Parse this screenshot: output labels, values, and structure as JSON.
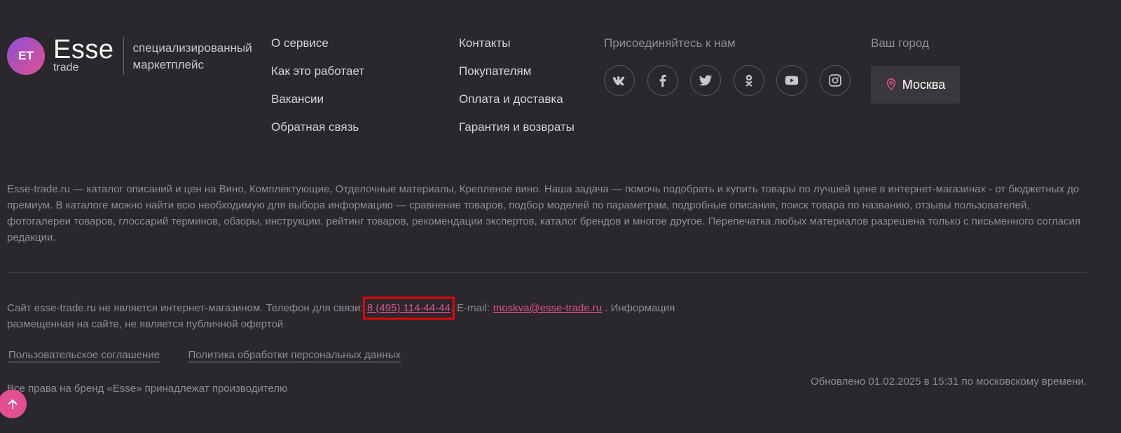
{
  "logo": {
    "initials": "ET",
    "name": "Esse",
    "sub": "trade",
    "tagline": "специализированный маркетплейс"
  },
  "nav_col1": [
    {
      "label": "О сервисе"
    },
    {
      "label": "Как это работает"
    },
    {
      "label": "Вакансии"
    },
    {
      "label": "Обратная связь"
    }
  ],
  "nav_col2": [
    {
      "label": "Контакты"
    },
    {
      "label": "Покупателям"
    },
    {
      "label": "Оплата и доставка"
    },
    {
      "label": "Гарантия и возвраты"
    }
  ],
  "social": {
    "title": "Присоединяйтесь к нам",
    "icons": [
      "vk-icon",
      "facebook-icon",
      "twitter-icon",
      "odnoklassniki-icon",
      "youtube-icon",
      "instagram-icon"
    ]
  },
  "city": {
    "title": "Ваш город",
    "value": "Москва"
  },
  "about": "Esse-trade.ru — каталог описаний и цен на Вино, Комплектующие, Отделочные материалы, Крепленое вино. Наша задача — помочь подобрать и купить товары по лучшей цене в интернет-магазинах - от бюджетных до премиум. В каталоге можно найти всю необходимую для выбора информацию — сравнение товаров, подбор моделей по параметрам, подробные описания, поиск товара по названию, отзывы пользователей, фотогалереи товаров, глоссарий терминов, обзоры, инструкции, рейтинг товаров, рекомендации экспертов, каталог брендов и многое другое. Перепечатка любых материалов разрешена только с письменного согласия редакции.",
  "disclaimer": {
    "before_phone": "Сайт esse-trade.ru не является интернет-магазином. Телефон для связи:",
    "phone": "8 (495) 114-44-44",
    "email_label": ". E-mail:",
    "email": "moskva@esse-trade.ru",
    "after_email": " . Информация размещенная на сайте, не является публичной офертой"
  },
  "legal_links": {
    "agreement": "Пользовательское соглашение",
    "privacy": "Политика обработки персональных данных"
  },
  "rights": "Все права на бренд «Esse» принадлежат производителю",
  "updated": "Обновлено 01.02.2025 в 15:31 по московскому времени.",
  "colors": {
    "background": "#2a282c",
    "accent": "#e0508f",
    "highlight_box": "#e0060e"
  }
}
